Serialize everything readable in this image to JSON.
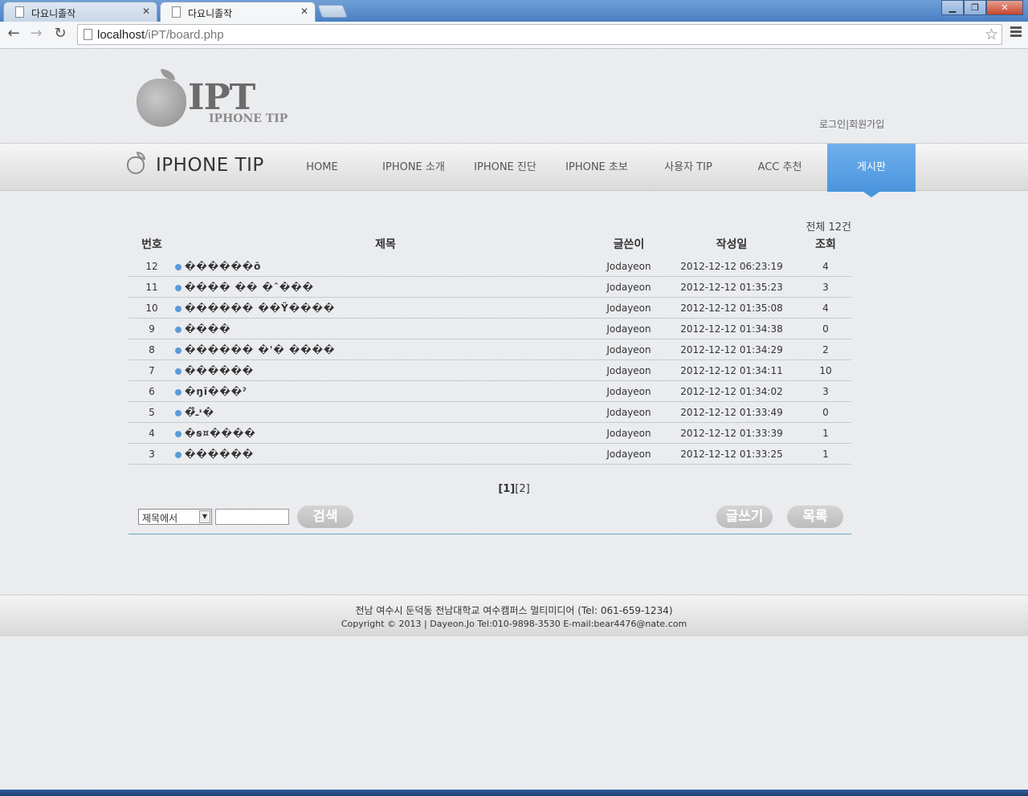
{
  "browser": {
    "tabs": [
      {
        "label": "다요니졸작",
        "active": false
      },
      {
        "label": "다요니졸작",
        "active": true
      }
    ],
    "url_host": "localhost",
    "url_path": "/iPT/board.php"
  },
  "site": {
    "logo_text": "IPT",
    "logo_sub": "IPHONE TIP",
    "top_links": {
      "login": "로그인",
      "sep": "|",
      "join": "회원가입"
    },
    "brand": "IPHONE TIP",
    "nav": [
      {
        "label": "HOME",
        "active": false
      },
      {
        "label": "IPHONE 소개",
        "active": false
      },
      {
        "label": "IPHONE 진단",
        "active": false
      },
      {
        "label": "IPHONE 초보",
        "active": false
      },
      {
        "label": "사용자 TIP",
        "active": false
      },
      {
        "label": "ACC 추천",
        "active": false
      },
      {
        "label": "게시판",
        "active": true
      }
    ]
  },
  "board": {
    "total": "전체 12건",
    "headers": {
      "num": "번호",
      "title": "제목",
      "author": "글쓴이",
      "date": "작성일",
      "views": "조회"
    },
    "rows": [
      {
        "num": "12",
        "title": "������ō",
        "author": "Jodayeon",
        "date": "2012-12-12 06:23:19",
        "views": "4"
      },
      {
        "num": "11",
        "title": "���� �� �ˆ���",
        "author": "Jodayeon",
        "date": "2012-12-12 01:35:23",
        "views": "3"
      },
      {
        "num": "10",
        "title": "������ ��Ÿ����",
        "author": "Jodayeon",
        "date": "2012-12-12 01:35:08",
        "views": "4"
      },
      {
        "num": "9",
        "title": "����",
        "author": "Jodayeon",
        "date": "2012-12-12 01:34:38",
        "views": "0"
      },
      {
        "num": "8",
        "title": "������ �'� ����",
        "author": "Jodayeon",
        "date": "2012-12-12 01:34:29",
        "views": "2"
      },
      {
        "num": "7",
        "title": "������",
        "author": "Jodayeon",
        "date": "2012-12-12 01:34:11",
        "views": "10"
      },
      {
        "num": "6",
        "title": "�ŋĭ���ˀ",
        "author": "Jodayeon",
        "date": "2012-12-12 01:34:02",
        "views": "3"
      },
      {
        "num": "5",
        "title": "�ـ̊ᶦ�",
        "author": "Jodayeon",
        "date": "2012-12-12 01:33:49",
        "views": "0"
      },
      {
        "num": "4",
        "title": "�ꞩ¤����",
        "author": "Jodayeon",
        "date": "2012-12-12 01:33:39",
        "views": "1"
      },
      {
        "num": "3",
        "title": "������",
        "author": "Jodayeon",
        "date": "2012-12-12 01:33:25",
        "views": "1"
      }
    ],
    "pages": {
      "current": "[1]",
      "other": "[2]"
    },
    "search": {
      "select_value": "제목에서",
      "input_value": "",
      "search_label": "검색"
    },
    "write_label": "글쓰기",
    "list_label": "목록"
  },
  "footer": {
    "line1": "전남 여수시 둔덕동 전남대학교 여수캠퍼스 멀티미디어 (Tel: 061-659-1234)",
    "line2": "Copyright © 2013 | Dayeon.Jo  Tel:010-9898-3530 E-mail:bear4476@nate.com"
  },
  "colors": {
    "accent": "#4a95de",
    "bullet": "#5c9bd8",
    "rule": "#6aa7c9"
  }
}
